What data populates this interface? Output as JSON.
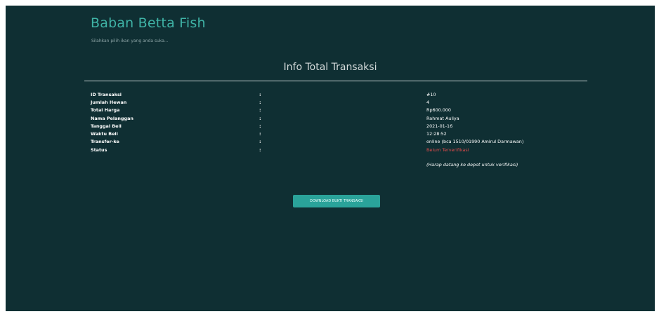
{
  "header": {
    "brand": "Baban Betta Fish",
    "tagline": "Silahkan pilih ikan yang anda suka..."
  },
  "main": {
    "title": "Info Total Transaksi",
    "rows": [
      {
        "label": "ID Transaksi",
        "sep": ":",
        "value": "#10"
      },
      {
        "label": "Jumlah Hewan",
        "sep": ":",
        "value": "4"
      },
      {
        "label": "Total Harga",
        "sep": ":",
        "value": "Rp600.000"
      },
      {
        "label": "Nama Pelanggan",
        "sep": ":",
        "value": "Rahmat Auliya"
      },
      {
        "label": "Tanggal Beli",
        "sep": ":",
        "value": "2021-01-16"
      },
      {
        "label": "Waktu Beli",
        "sep": ":",
        "value": "12:28:52"
      },
      {
        "label": "Transfer-ke",
        "sep": ":",
        "value": "online (bca 1510/01990 Amirul Darmawan)"
      },
      {
        "label": "Status",
        "sep": ":",
        "value": "Belum Terverifikasi"
      }
    ],
    "status_note": "(Harap datang ke depot untuk verifikasi)",
    "download_label": "DOWNLOAD BUKTI TRANSAKSI"
  },
  "colors": {
    "background": "#0f2f33",
    "brand": "#3fb3a6",
    "alert": "#e04b4b",
    "button": "#2aa39a"
  }
}
